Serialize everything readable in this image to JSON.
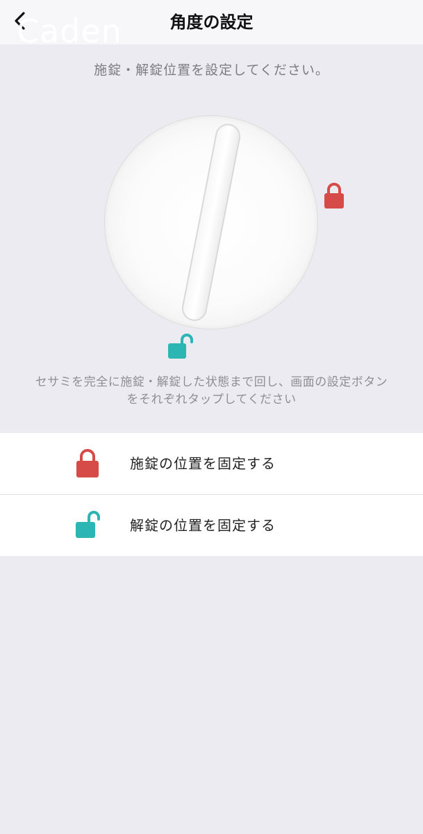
{
  "header": {
    "title": "角度の設定",
    "watermark": "Caden",
    "back_icon": "chevron-left-icon"
  },
  "instruction": "施錠・解錠位置を設定してください。",
  "dial": {
    "lock_icon": "lock-closed-icon",
    "unlock_icon": "lock-open-icon"
  },
  "hint": {
    "line1": "セサミを完全に施錠・解錠した状態まで回し、画面の設定ボタン",
    "line2": "をそれぞれタップしてください"
  },
  "actions": {
    "lock_label": "施錠の位置を固定する",
    "unlock_label": "解錠の位置を固定する"
  },
  "colors": {
    "lock": "#D64A47",
    "unlock": "#2BB5B3",
    "background": "#ECEBF1"
  }
}
